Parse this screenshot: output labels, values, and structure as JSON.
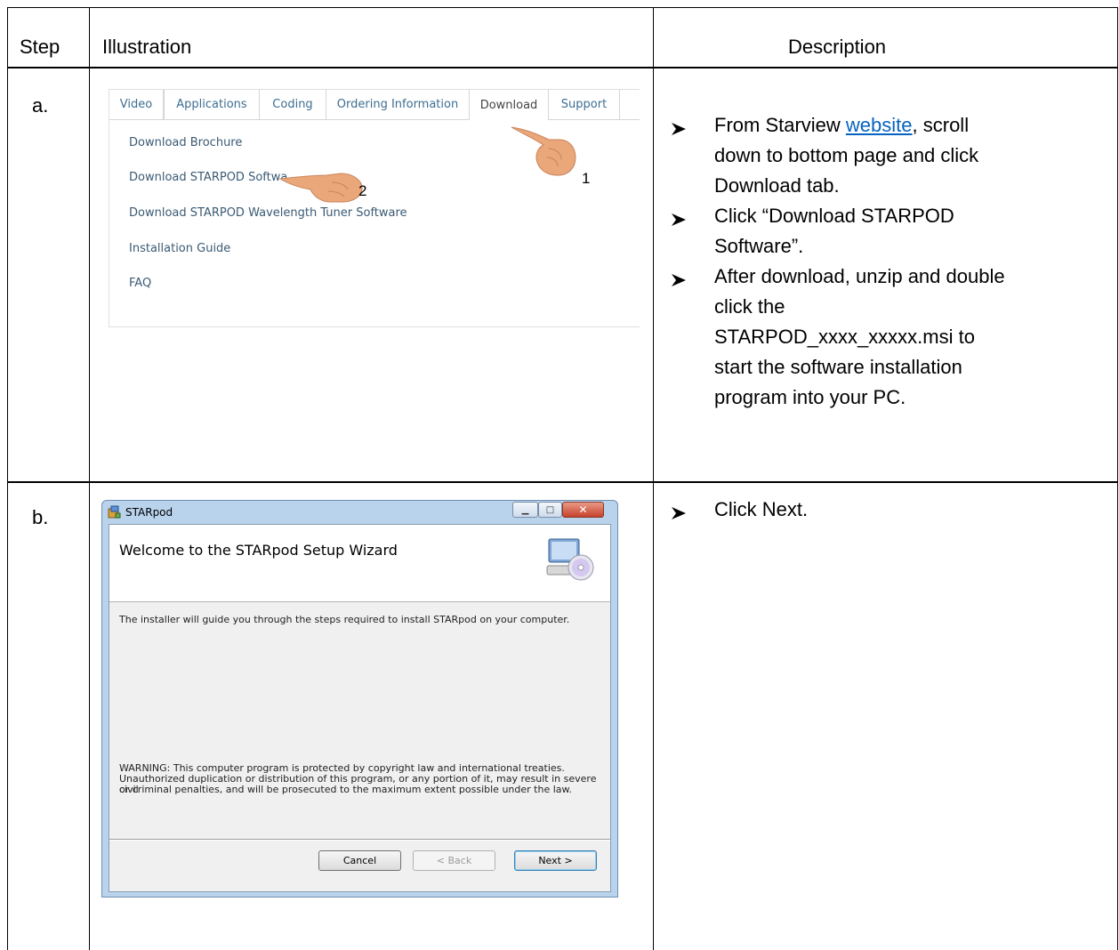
{
  "header": {
    "step": "Step",
    "illustration": "Illustration",
    "description": "Description"
  },
  "rows": [
    {
      "step": "a.",
      "webpage": {
        "tabs": [
          "Video",
          "Applications",
          "Coding",
          "Ordering Information",
          "Download",
          "Support"
        ],
        "active_tab": "Download",
        "links": [
          "Download Brochure",
          "Download STARPOD Softwa",
          "Download STARPOD Wavelength Tuner Software",
          "Installation Guide",
          "FAQ"
        ],
        "callout_1": "1",
        "callout_2": "2"
      },
      "description": {
        "b1_pre": "From Starview ",
        "b1_link": "website",
        "b1_post": ", scroll",
        "b1_line2": "down to bottom page and click",
        "b1_line3": "Download tab.",
        "b2_line1": "Click “Download STARPOD",
        "b2_line2": "Software”.",
        "b3_line1": "After download, unzip and double",
        "b3_line2": "click the",
        "b3_line3": "STARPOD_xxxx_xxxxx.msi to",
        "b3_line4": "start the software installation",
        "b3_line5": "program into your PC."
      }
    },
    {
      "step": "b.",
      "wizard": {
        "window_title": "STARpod",
        "heading": "Welcome to the STARpod Setup Wizard",
        "intro": "The installer will guide you through the steps required to install STARpod on your computer.",
        "warning_1": "WARNING: This computer program is protected by copyright law and international treaties.",
        "warning_2": "Unauthorized duplication or distribution of this program, or any portion of it, may result in severe civil",
        "warning_3": "or criminal penalties, and will be prosecuted to the maximum extent possible under the law.",
        "cancel": "Cancel",
        "back": "< Back",
        "next": "Next >"
      },
      "description": {
        "b1": "Click Next."
      }
    }
  ],
  "colors": {
    "link": "#0563c1",
    "tab_text": "#3c6e91",
    "wizard_frame": "#b9d3ec"
  }
}
